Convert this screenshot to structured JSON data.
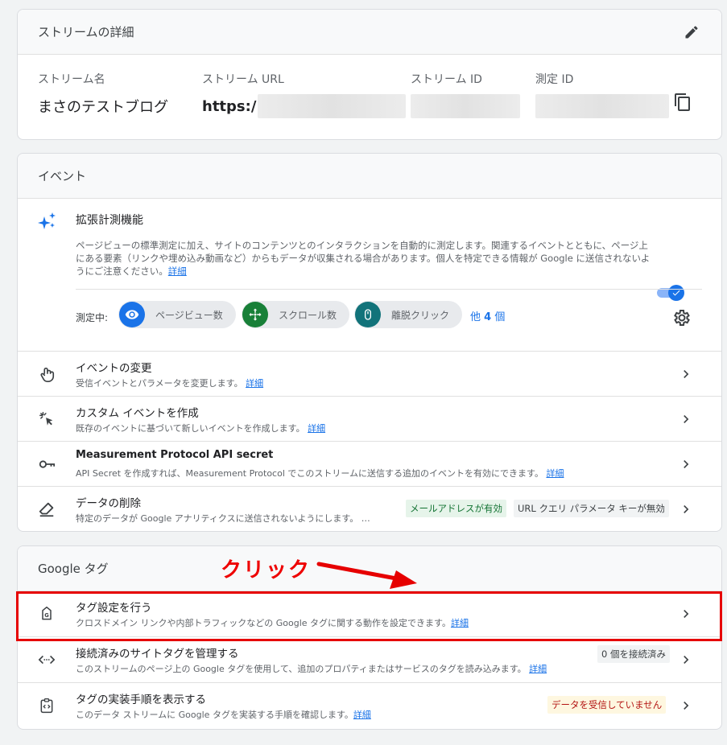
{
  "stream": {
    "title": "ストリームの詳細",
    "name_label": "ストリーム名",
    "name_value": "まさのテストブログ",
    "url_label": "ストリーム URL",
    "url_value": "https:/",
    "id_label": "ストリーム ID",
    "mid_label": "測定 ID"
  },
  "events": {
    "title": "イベント",
    "enhanced": {
      "title": "拡張計測機能",
      "desc": "ページビューの標準測定に加え、サイトのコンテンツとのインタラクションを自動的に測定します。関連するイベントとともに、ページ上にある要素（リンクや埋め込み動画など）からもデータが収集される場合があります。個人を特定できる情報が Google に送信されないようにご注意ください。",
      "link": "詳細",
      "toggle_on": true,
      "measuring_label": "測定中:",
      "chips": [
        "ページビュー数",
        "スクロール数",
        "離脱クリック"
      ],
      "more_prefix": "他 ",
      "more_count": "4",
      "more_suffix": " 個"
    },
    "rows": [
      {
        "title": "イベントの変更",
        "desc": "受信イベントとパラメータを変更します。",
        "link": "詳細"
      },
      {
        "title": "カスタム イベントを作成",
        "desc": "既存のイベントに基づいて新しいイベントを作成します。",
        "link": "詳細"
      },
      {
        "title": "Measurement Protocol API secret",
        "desc": "API Secret を作成すれば、Measurement Protocol でこのストリームに送信する追加のイベントを有効にできます。",
        "link": "詳細"
      },
      {
        "title": "データの削除",
        "desc": "特定のデータが Google アナリティクスに送信されないようにします。 …",
        "badge1": "メールアドレスが有効",
        "badge2": "URL クエリ パラメータ キーが無効"
      }
    ]
  },
  "gtag": {
    "title": "Google タグ",
    "rows": [
      {
        "title": "タグ設定を行う",
        "desc": "クロスドメイン リンクや内部トラフィックなどの Google タグに関する動作を設定できます。",
        "link": "詳細"
      },
      {
        "title": "接続済みのサイトタグを管理する",
        "desc": "このストリームのページ上の Google タグを使用して、追加のプロパティまたはサービスのタグを読み込みます。",
        "link": "詳細",
        "badge": "0 個を接続済み"
      },
      {
        "title": "タグの実装手順を表示する",
        "desc": "このデータ ストリームに Google タグを実装する手順を確認します。",
        "link": "詳細",
        "badge": "データを受信していません"
      }
    ]
  },
  "annotation": {
    "text": "クリック"
  },
  "colors": {
    "accent": "#1a73e8",
    "annotation": "#e60000",
    "chip_blue": "#1a73e8",
    "chip_green": "#188038",
    "chip_teal": "#12737a"
  }
}
